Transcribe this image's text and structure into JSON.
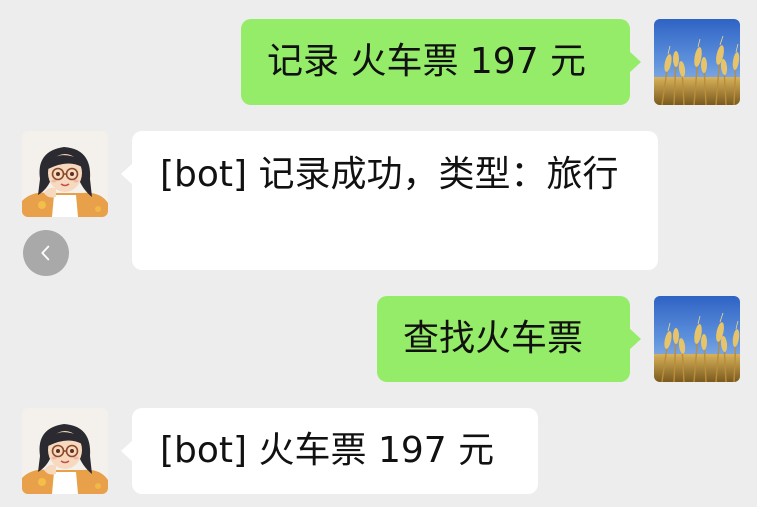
{
  "messages": [
    {
      "side": "out",
      "sender": "user",
      "avatar_icon": "wheat-field-avatar",
      "text": "记录 火车票 197 元"
    },
    {
      "side": "in",
      "sender": "bot",
      "avatar_icon": "cartoon-girl-avatar",
      "text": "[bot] 记录成功，类型：旅行"
    },
    {
      "side": "out",
      "sender": "user",
      "avatar_icon": "wheat-field-avatar",
      "text": "查找火车票"
    },
    {
      "side": "in",
      "sender": "bot",
      "avatar_icon": "cartoon-girl-avatar",
      "text": "[bot] 火车票 197 元"
    }
  ],
  "back_button_icon": "chevron-left-icon",
  "colors": {
    "background": "#ededed",
    "outgoing_bubble": "#95ec69",
    "incoming_bubble": "#ffffff",
    "text": "#111111"
  }
}
